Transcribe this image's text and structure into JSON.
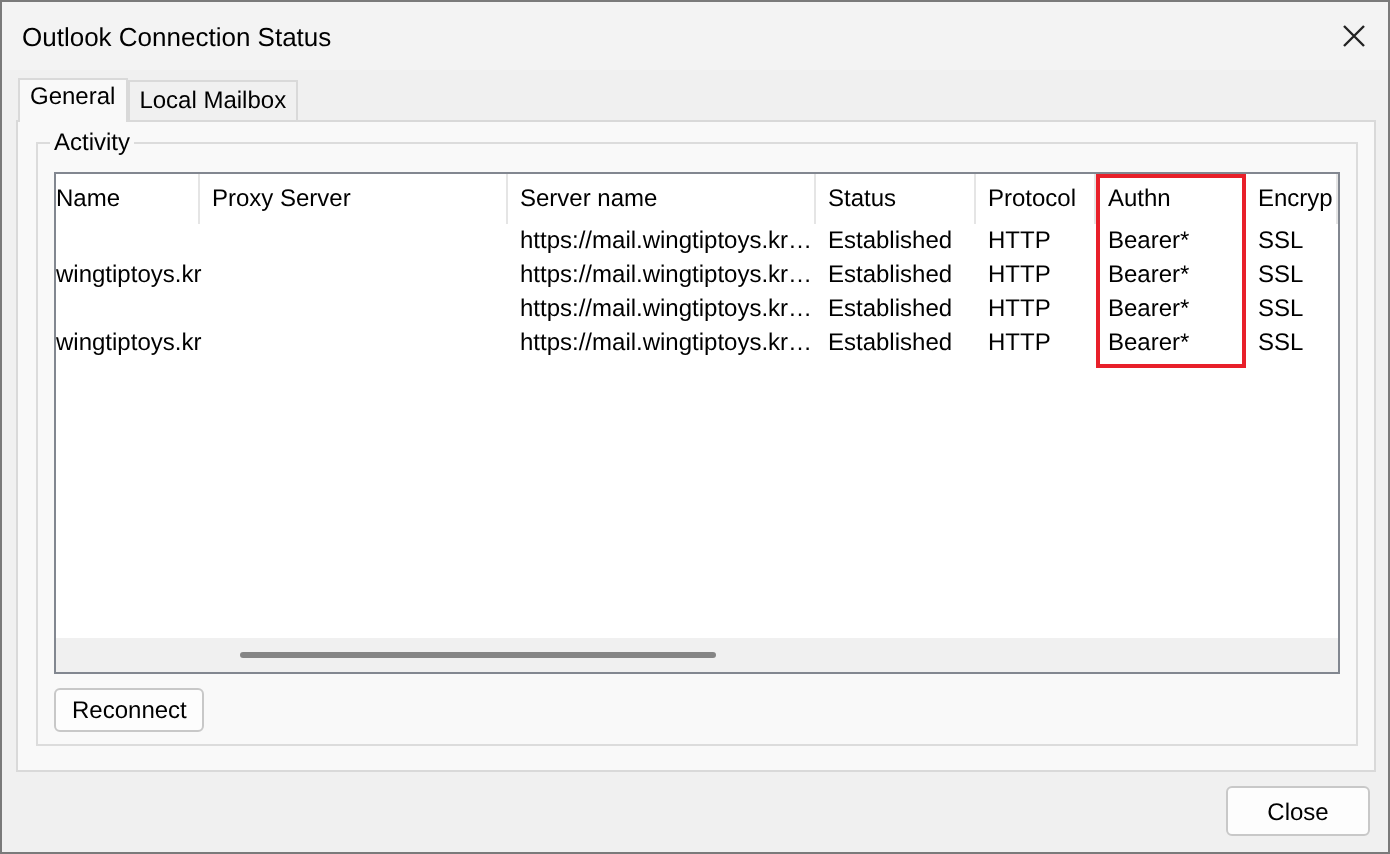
{
  "window": {
    "title": "Outlook Connection Status"
  },
  "tabs": [
    {
      "label": "General",
      "selected": true
    },
    {
      "label": "Local Mailbox",
      "selected": false
    }
  ],
  "group": {
    "title": "Activity"
  },
  "table": {
    "columns": [
      {
        "label": "Name",
        "highlighted": false
      },
      {
        "label": "Proxy Server",
        "highlighted": false
      },
      {
        "label": "Server name",
        "highlighted": false
      },
      {
        "label": "Status",
        "highlighted": false
      },
      {
        "label": "Protocol",
        "highlighted": false
      },
      {
        "label": "Authn",
        "highlighted": true
      },
      {
        "label": "Encryp",
        "highlighted": false
      }
    ],
    "rows": [
      [
        "",
        "",
        "https://mail.wingtiptoys.kr…",
        "Established",
        "HTTP",
        "Bearer*",
        "SSL"
      ],
      [
        "wingtiptoys.kr",
        "",
        "https://mail.wingtiptoys.kr…",
        "Established",
        "HTTP",
        "Bearer*",
        "SSL"
      ],
      [
        "",
        "",
        "https://mail.wingtiptoys.kr…",
        "Established",
        "HTTP",
        "Bearer*",
        "SSL"
      ],
      [
        "wingtiptoys.kr",
        "",
        "https://mail.wingtiptoys.kr…",
        "Established",
        "HTTP",
        "Bearer*",
        "SSL"
      ]
    ]
  },
  "buttons": {
    "reconnect": "Reconnect",
    "close": "Close"
  }
}
